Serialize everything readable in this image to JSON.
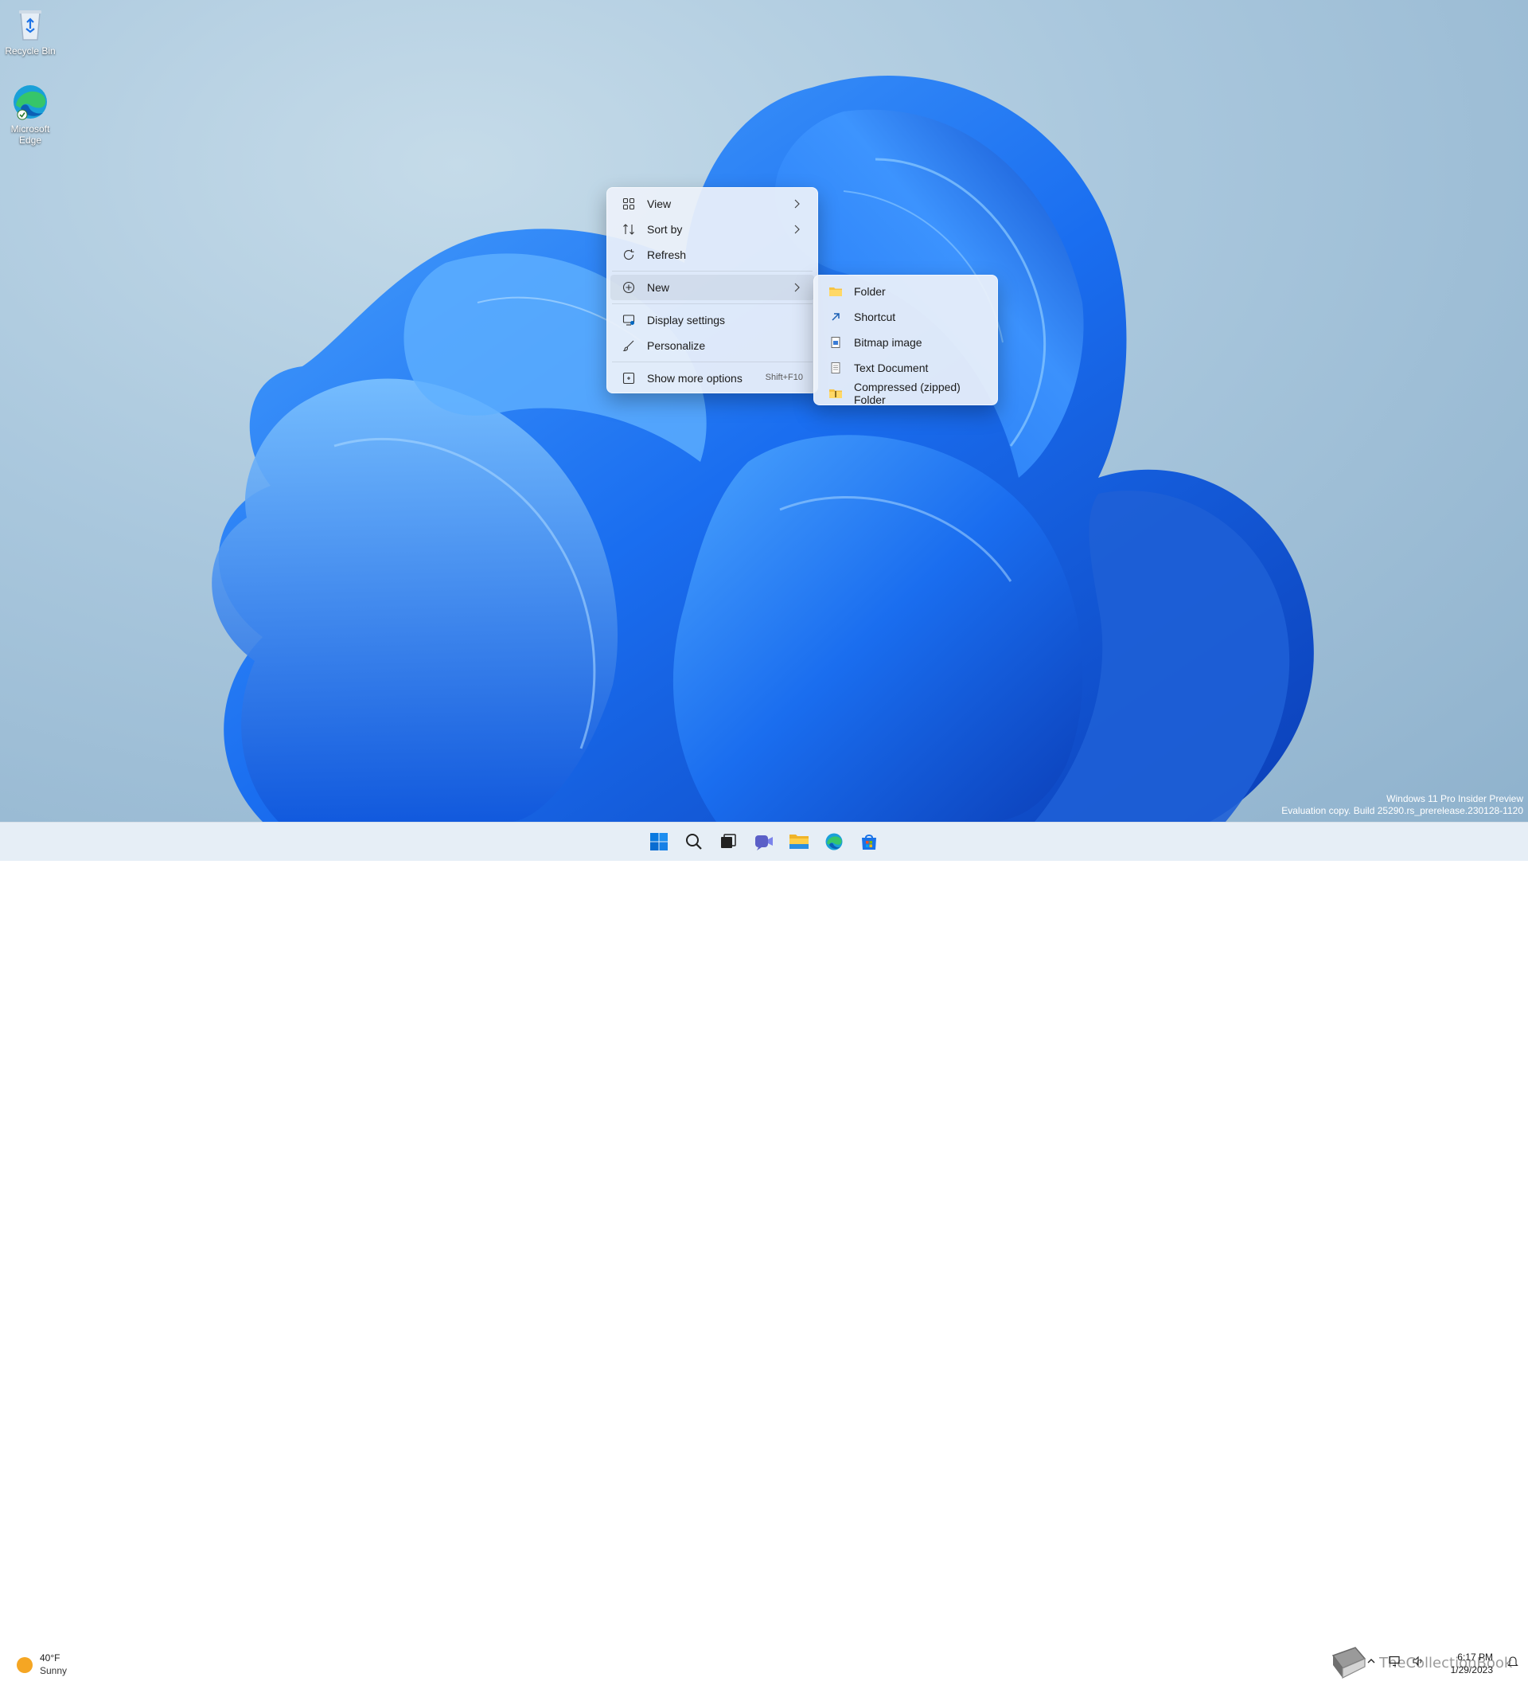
{
  "desktop": {
    "icons": [
      {
        "label": "Recycle Bin"
      },
      {
        "label": "Microsoft Edge"
      }
    ]
  },
  "context_menu": {
    "items": [
      {
        "label": "View",
        "icon": "view-grid-icon"
      },
      {
        "label": "Sort by",
        "icon": "sort-icon"
      },
      {
        "label": "Refresh",
        "icon": "refresh-icon"
      },
      {
        "label": "New",
        "icon": "new-plus-icon"
      },
      {
        "label": "Display settings",
        "icon": "display-icon"
      },
      {
        "label": "Personalize",
        "icon": "brush-icon"
      },
      {
        "label": "Show more options",
        "icon": "more-options-icon",
        "accelerator": "Shift+F10"
      }
    ]
  },
  "new_submenu": {
    "items": [
      {
        "label": "Folder",
        "icon": "folder-icon"
      },
      {
        "label": "Shortcut",
        "icon": "shortcut-icon"
      },
      {
        "label": "Bitmap image",
        "icon": "bitmap-icon"
      },
      {
        "label": "Text Document",
        "icon": "text-document-icon"
      },
      {
        "label": "Compressed (zipped) Folder",
        "icon": "zip-folder-icon"
      }
    ]
  },
  "watermark": {
    "line1": "Windows 11 Pro Insider Preview",
    "line2": "Evaluation copy. Build 25290.rs_prerelease.230128-1120"
  },
  "taskbar": {
    "weather": {
      "temp": "40°F",
      "condition": "Sunny"
    },
    "apps": [
      "start-icon",
      "search-icon",
      "task-view-icon",
      "chat-icon",
      "file-explorer-icon",
      "edge-icon",
      "store-icon"
    ],
    "clock": {
      "time": "6:17 PM",
      "date": "1/29/2023"
    }
  },
  "site_watermark": "TheCollectionBook",
  "colors": {
    "accent": "#0067c0",
    "folder": "#f6c343"
  }
}
